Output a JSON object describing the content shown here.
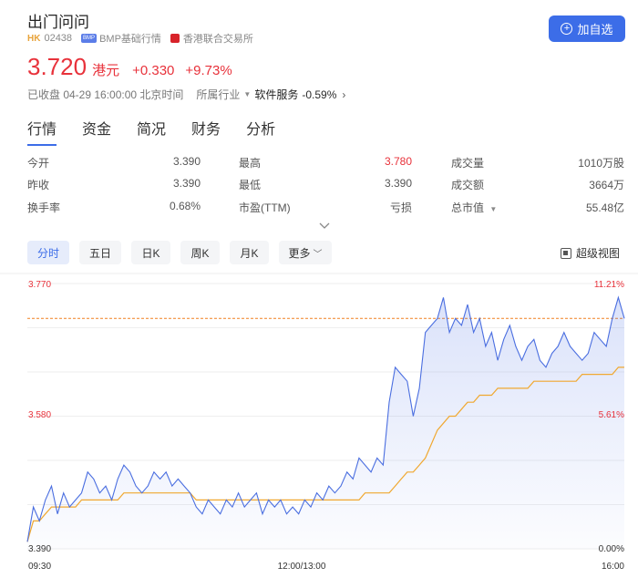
{
  "header": {
    "name": "出门问问",
    "market_tag": "HK",
    "code": "02438",
    "quote_source": "BMP基础行情",
    "exchange": "香港联合交易所",
    "add_button": "加自选"
  },
  "price": {
    "last": "3.720",
    "currency": "港元",
    "change": "+0.330",
    "change_pct": "+9.73%"
  },
  "status": {
    "text": "已收盘 04-29 16:00:00 北京时间",
    "industry_label": "所属行业",
    "industry_name": "软件服务",
    "industry_change": "-0.59%"
  },
  "tabs": [
    "行情",
    "资金",
    "简况",
    "财务",
    "分析"
  ],
  "active_tab": "行情",
  "stats": [
    [
      {
        "label": "今开",
        "value": "3.390"
      },
      {
        "label": "最高",
        "value": "3.780",
        "color": "red"
      },
      {
        "label": "成交量",
        "value": "1010万股"
      }
    ],
    [
      {
        "label": "昨收",
        "value": "3.390"
      },
      {
        "label": "最低",
        "value": "3.390"
      },
      {
        "label": "成交额",
        "value": "3664万"
      }
    ],
    [
      {
        "label": "换手率",
        "value": "0.68%"
      },
      {
        "label": "市盈(TTM)",
        "value": "亏损"
      },
      {
        "label": "总市值",
        "value": "55.48亿"
      }
    ]
  ],
  "period_tabs": [
    "分时",
    "五日",
    "日K",
    "周K",
    "月K",
    "更多"
  ],
  "active_period": "分时",
  "super_view": "超级视图",
  "colors": {
    "accent": "#3c6de8",
    "up": "#e8323b",
    "price_line": "#4a6ee0",
    "avg_line": "#f0a830"
  },
  "chart_data": {
    "type": "line",
    "price_labels": [
      "3.770",
      "3.580",
      "3.390"
    ],
    "pct_labels": [
      "11.21%",
      "5.61%",
      "0.00%"
    ],
    "time_labels": [
      "09:30",
      "12:00/13:00",
      "16:00"
    ],
    "ylim": [
      3.39,
      3.77
    ],
    "prev_close": 3.39,
    "reference_line": 3.72,
    "series": [
      {
        "values": [
          3.4,
          3.45,
          3.43,
          3.46,
          3.48,
          3.44,
          3.47,
          3.45,
          3.46,
          3.47,
          3.5,
          3.49,
          3.47,
          3.48,
          3.46,
          3.49,
          3.51,
          3.5,
          3.48,
          3.47,
          3.48,
          3.5,
          3.49,
          3.5,
          3.48,
          3.49,
          3.48,
          3.47,
          3.45,
          3.44,
          3.46,
          3.45,
          3.44,
          3.46,
          3.45,
          3.47,
          3.45,
          3.46,
          3.47,
          3.44,
          3.46,
          3.45,
          3.46,
          3.44,
          3.45,
          3.44,
          3.46,
          3.45,
          3.47,
          3.46,
          3.48,
          3.47,
          3.48,
          3.5,
          3.49,
          3.52,
          3.51,
          3.5,
          3.52,
          3.51,
          3.6,
          3.65,
          3.64,
          3.63,
          3.58,
          3.62,
          3.7,
          3.71,
          3.72,
          3.75,
          3.7,
          3.72,
          3.71,
          3.74,
          3.7,
          3.72,
          3.68,
          3.7,
          3.66,
          3.69,
          3.71,
          3.68,
          3.66,
          3.68,
          3.69,
          3.66,
          3.65,
          3.67,
          3.68,
          3.7,
          3.68,
          3.67,
          3.66,
          3.67,
          3.7,
          3.69,
          3.68,
          3.72,
          3.75,
          3.72
        ]
      },
      {
        "values": [
          3.4,
          3.43,
          3.43,
          3.44,
          3.45,
          3.45,
          3.45,
          3.45,
          3.45,
          3.46,
          3.46,
          3.46,
          3.46,
          3.46,
          3.46,
          3.46,
          3.47,
          3.47,
          3.47,
          3.47,
          3.47,
          3.47,
          3.47,
          3.47,
          3.47,
          3.47,
          3.47,
          3.47,
          3.46,
          3.46,
          3.46,
          3.46,
          3.46,
          3.46,
          3.46,
          3.46,
          3.46,
          3.46,
          3.46,
          3.46,
          3.46,
          3.46,
          3.46,
          3.46,
          3.46,
          3.46,
          3.46,
          3.46,
          3.46,
          3.46,
          3.46,
          3.46,
          3.46,
          3.46,
          3.46,
          3.46,
          3.47,
          3.47,
          3.47,
          3.47,
          3.47,
          3.48,
          3.49,
          3.5,
          3.5,
          3.51,
          3.52,
          3.54,
          3.56,
          3.57,
          3.58,
          3.58,
          3.59,
          3.6,
          3.6,
          3.61,
          3.61,
          3.61,
          3.62,
          3.62,
          3.62,
          3.62,
          3.62,
          3.62,
          3.63,
          3.63,
          3.63,
          3.63,
          3.63,
          3.63,
          3.63,
          3.63,
          3.64,
          3.64,
          3.64,
          3.64,
          3.64,
          3.64,
          3.65,
          3.65
        ]
      }
    ]
  }
}
